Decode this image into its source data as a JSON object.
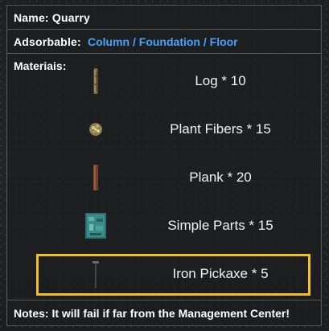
{
  "name": {
    "label": "Name:",
    "value": "Quarry"
  },
  "adsorbable": {
    "label": "Adsorbable:",
    "value": "Column / Foundation / Floor",
    "value_color": "#47a3ff"
  },
  "materials": {
    "label": "Materiais:",
    "items": [
      {
        "icon": "log-icon",
        "text": "Log * 10"
      },
      {
        "icon": "plant-fibers-icon",
        "text": "Plant Fibers * 15"
      },
      {
        "icon": "plank-icon",
        "text": "Plank * 20"
      },
      {
        "icon": "simple-parts-icon",
        "text": "Simple Parts * 15"
      },
      {
        "icon": "iron-pickaxe-icon",
        "text": "Iron Pickaxe * 5",
        "highlighted": true
      }
    ],
    "highlight_color": "#f2c11d"
  },
  "notes": {
    "text": "Notes:  It will fail if far from the Management Center!"
  }
}
